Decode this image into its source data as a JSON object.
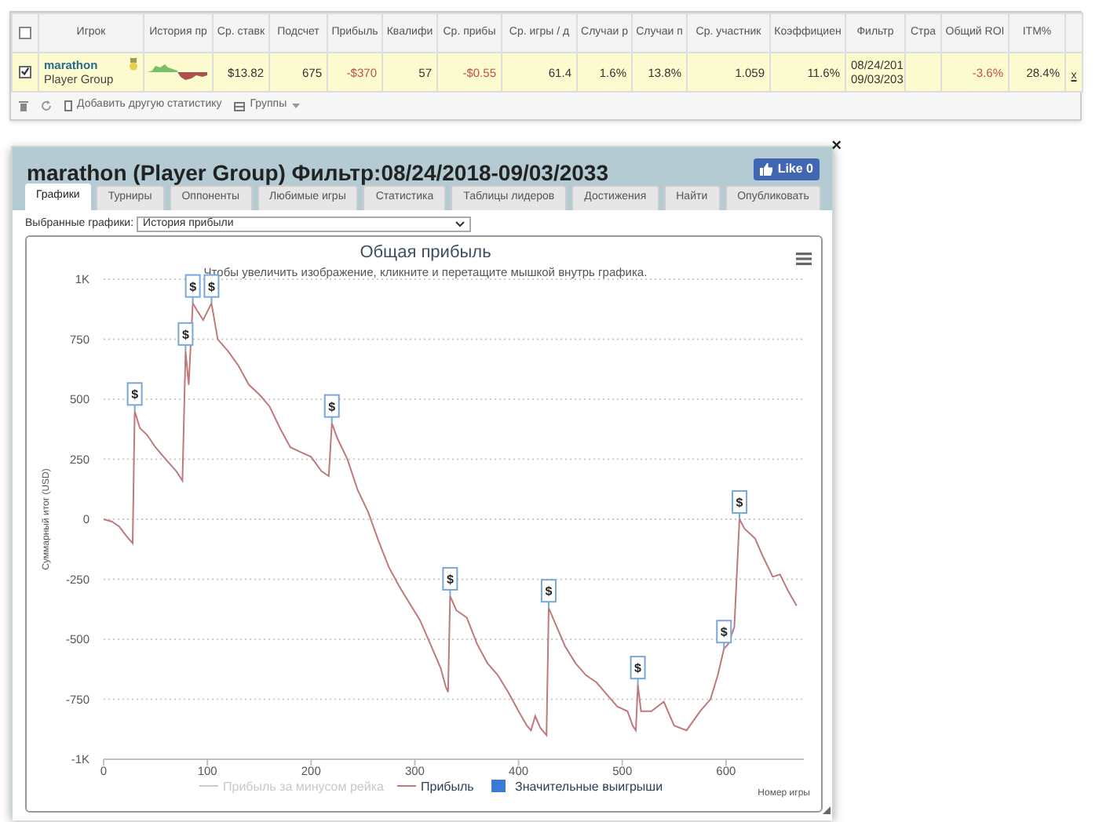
{
  "table": {
    "select_all_checked": false,
    "columns": [
      "Игрок",
      "История пр",
      "Ср. ставк",
      "Подсчет",
      "Прибыль",
      "Квалифи",
      "Ср. прибы",
      "Ср. игры / д",
      "Случаи р",
      "Случаи п",
      "Ср. участник",
      "Коэффициен",
      "Фильтр",
      "Стра",
      "Общий ROI",
      "ITM%"
    ],
    "rows": [
      {
        "selected": true,
        "remove": "x",
        "cells": [
          {
            "kind": "player",
            "text": "marathon",
            "subtext": "Player Group"
          },
          {
            "kind": "sparkline"
          },
          {
            "text": "$13.82",
            "negative": false
          },
          {
            "text": "675",
            "negative": false
          },
          {
            "text": "-$370",
            "negative": true
          },
          {
            "text": "57",
            "negative": false
          },
          {
            "text": "-$0.55",
            "negative": true
          },
          {
            "text": "61.4",
            "negative": false
          },
          {
            "text": "1.6%",
            "negative": false
          },
          {
            "text": "13.8%",
            "negative": false
          },
          {
            "text": "1.059",
            "negative": false
          },
          {
            "text": "11.6%",
            "negative": false
          },
          {
            "text": "08/24/201\n09/03/203",
            "negative": false
          },
          {
            "kind": "empty"
          },
          {
            "text": "-3.6%",
            "negative": true
          },
          {
            "text": "28.4%",
            "negative": false
          }
        ]
      }
    ]
  },
  "toolbar": {
    "add_stats": "Добавить другую статистику",
    "groups": "Группы"
  },
  "window": {
    "title": "marathon (Player Group) Фильтр:08/24/2018-09/03/2033",
    "like": "Like 0",
    "close": "×",
    "tabs": [
      {
        "label": "Графики",
        "selected": true
      },
      {
        "label": "Турниры",
        "selected": false
      },
      {
        "label": "Оппоненты",
        "selected": false
      },
      {
        "label": "Любимые игры",
        "selected": false
      },
      {
        "label": "Статистика",
        "selected": false
      },
      {
        "label": "Таблицы лидеров",
        "selected": false
      },
      {
        "label": "Достижения",
        "selected": false
      },
      {
        "label": "Найти",
        "selected": false
      },
      {
        "label": "Опубликовать",
        "selected": false
      }
    ]
  },
  "chart_selector": {
    "label": "Выбранные графики:",
    "value": "История прибыли"
  },
  "chart": {
    "subtitle": "Чтобы увеличить изображение, кликните и перетащите мышкой внутрь графика.",
    "legend": [
      {
        "label": "Прибыль за минусом рейка",
        "kind": "line",
        "enabled": false
      },
      {
        "label": "Значительные выигрыши",
        "kind": "flag",
        "enabled": true
      }
    ],
    "chart_data": {
      "type": "line",
      "grid": true,
      "title": "Общая прибыль",
      "xlabel": "Номер игры",
      "ylabel": "Суммарный итог (USD)",
      "xlim": [
        0,
        675
      ],
      "ylim": [
        -1000,
        1000
      ],
      "xticks": [
        0,
        100,
        200,
        300,
        400,
        500,
        600
      ],
      "yticks": [
        {
          "value": -1000,
          "label": "-1K"
        },
        {
          "value": -750,
          "label": "-750"
        },
        {
          "value": -500,
          "label": "-500"
        },
        {
          "value": -250,
          "label": "-250"
        },
        {
          "value": 0,
          "label": "0"
        },
        {
          "value": 250,
          "label": "250"
        },
        {
          "value": 500,
          "label": "500"
        },
        {
          "value": 750,
          "label": "750"
        },
        {
          "value": 1000,
          "label": "1K"
        }
      ],
      "x": [
        0,
        8,
        15,
        22,
        28,
        30,
        35,
        42,
        50,
        60,
        70,
        76,
        79,
        82,
        86,
        90,
        96,
        104,
        110,
        120,
        130,
        140,
        150,
        160,
        170,
        180,
        190,
        200,
        210,
        217,
        220,
        225,
        235,
        245,
        255,
        265,
        275,
        285,
        295,
        305,
        315,
        325,
        330,
        332,
        334,
        340,
        350,
        360,
        370,
        380,
        390,
        400,
        408,
        412,
        416,
        421,
        427,
        429,
        435,
        445,
        455,
        465,
        475,
        485,
        495,
        505,
        510,
        513,
        515,
        518,
        528,
        540,
        550,
        562,
        575,
        585,
        592,
        598,
        602,
        608,
        613,
        618,
        628,
        635,
        645,
        652,
        660,
        668
      ],
      "series": [
        {
          "name": "Прибыль",
          "color": "#c0797a",
          "values": [
            0,
            -10,
            -30,
            -70,
            -100,
            450,
            380,
            350,
            300,
            250,
            200,
            160,
            700,
            560,
            900,
            870,
            830,
            900,
            750,
            700,
            640,
            560,
            520,
            470,
            380,
            300,
            280,
            260,
            200,
            180,
            400,
            340,
            250,
            120,
            30,
            -90,
            -200,
            -280,
            -350,
            -420,
            -520,
            -620,
            -700,
            -720,
            -320,
            -380,
            -410,
            -520,
            -600,
            -650,
            -720,
            -800,
            -860,
            -880,
            -820,
            -870,
            -900,
            -370,
            -430,
            -530,
            -600,
            -650,
            -680,
            -730,
            -780,
            -800,
            -860,
            -880,
            -690,
            -800,
            -800,
            -760,
            -860,
            -880,
            -800,
            -750,
            -650,
            -540,
            -520,
            -450,
            0,
            -40,
            -80,
            -150,
            -240,
            -230,
            -300,
            -360
          ]
        }
      ],
      "annotations": [
        {
          "x": 30,
          "y": 450,
          "text": "$"
        },
        {
          "x": 79,
          "y": 700,
          "text": "$"
        },
        {
          "x": 86,
          "y": 900,
          "text": "$"
        },
        {
          "x": 104,
          "y": 900,
          "text": "$"
        },
        {
          "x": 220,
          "y": 400,
          "text": "$"
        },
        {
          "x": 334,
          "y": -320,
          "text": "$"
        },
        {
          "x": 429,
          "y": -370,
          "text": "$"
        },
        {
          "x": 515,
          "y": -690,
          "text": "$"
        },
        {
          "x": 598,
          "y": -540,
          "text": "$"
        },
        {
          "x": 613,
          "y": 0,
          "text": "$"
        }
      ]
    }
  }
}
